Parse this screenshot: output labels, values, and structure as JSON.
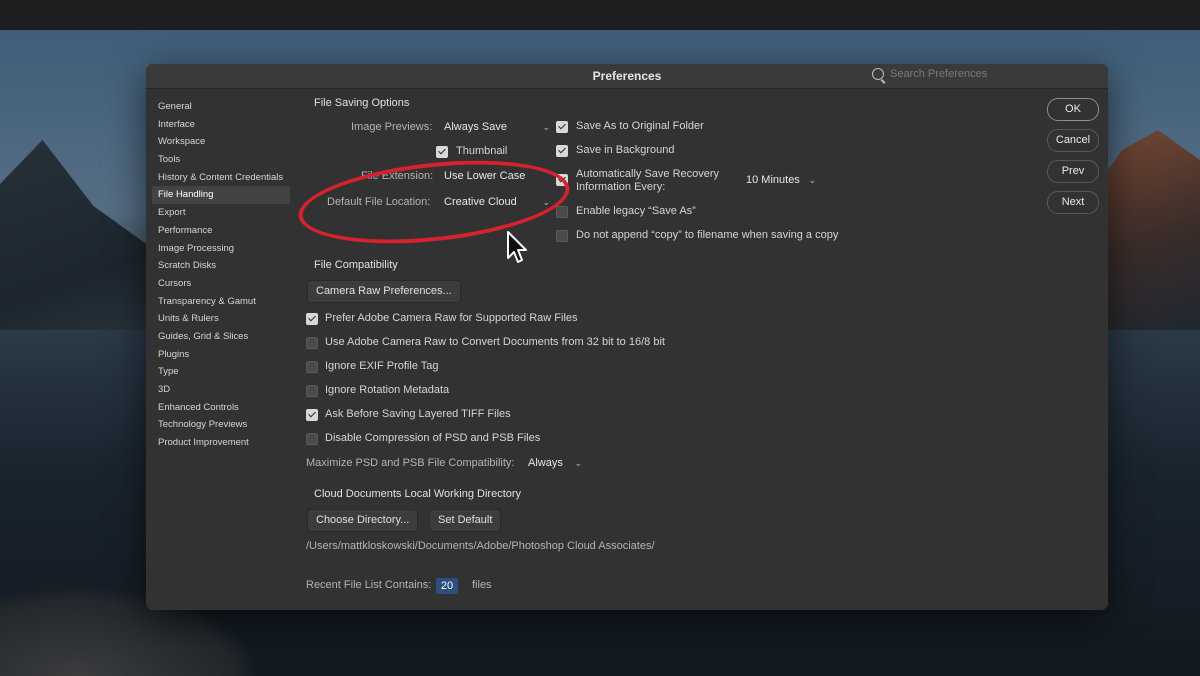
{
  "window": {
    "title": "Preferences",
    "search_placeholder": "Search Preferences"
  },
  "sidebar": {
    "items": [
      {
        "label": "General",
        "active": false
      },
      {
        "label": "Interface",
        "active": false
      },
      {
        "label": "Workspace",
        "active": false
      },
      {
        "label": "Tools",
        "active": false
      },
      {
        "label": "History & Content Credentials",
        "active": false
      },
      {
        "label": "File Handling",
        "active": true
      },
      {
        "label": "Export",
        "active": false
      },
      {
        "label": "Performance",
        "active": false
      },
      {
        "label": "Image Processing",
        "active": false
      },
      {
        "label": "Scratch Disks",
        "active": false
      },
      {
        "label": "Cursors",
        "active": false
      },
      {
        "label": "Transparency & Gamut",
        "active": false
      },
      {
        "label": "Units & Rulers",
        "active": false
      },
      {
        "label": "Guides, Grid & Slices",
        "active": false
      },
      {
        "label": "Plugins",
        "active": false
      },
      {
        "label": "Type",
        "active": false
      },
      {
        "label": "3D",
        "active": false
      },
      {
        "label": "Enhanced Controls",
        "active": false
      },
      {
        "label": "Technology Previews",
        "active": false
      },
      {
        "label": "Product Improvement",
        "active": false
      }
    ]
  },
  "file_saving": {
    "heading": "File Saving Options",
    "image_previews_label": "Image Previews:",
    "image_previews_value": "Always Save",
    "thumbnail_label": "Thumbnail",
    "thumbnail_checked": true,
    "file_extension_label": "File Extension:",
    "file_extension_value": "Use Lower Case",
    "default_location_label": "Default File Location:",
    "default_location_value": "Creative Cloud",
    "save_as_original_label": "Save As to Original Folder",
    "save_as_original_checked": true,
    "save_background_label": "Save in Background",
    "save_background_checked": true,
    "auto_save_label_1": "Automatically Save Recovery",
    "auto_save_label_2": "Information Every:",
    "auto_save_checked": true,
    "auto_save_interval": "10 Minutes",
    "legacy_save_as_label": "Enable legacy “Save As”",
    "legacy_save_as_checked": false,
    "no_copy_label": "Do not append “copy” to filename when saving a copy",
    "no_copy_checked": false
  },
  "file_compat": {
    "heading": "File Compatibility",
    "camera_raw_prefs_button": "Camera Raw Preferences...",
    "options": [
      {
        "label": "Prefer Adobe Camera Raw for Supported Raw Files",
        "checked": true
      },
      {
        "label": "Use Adobe Camera Raw to Convert Documents from 32 bit to 16/8 bit",
        "checked": false
      },
      {
        "label": "Ignore EXIF Profile Tag",
        "checked": false
      },
      {
        "label": "Ignore Rotation Metadata",
        "checked": false
      },
      {
        "label": "Ask Before Saving Layered TIFF Files",
        "checked": true
      },
      {
        "label": "Disable Compression of PSD and PSB Files",
        "checked": false
      }
    ],
    "maximize_label": "Maximize PSD and PSB File Compatibility:",
    "maximize_value": "Always"
  },
  "cloud": {
    "heading": "Cloud Documents Local Working Directory",
    "choose_button": "Choose Directory...",
    "default_button": "Set Default",
    "path": "/Users/mattkloskowski/Documents/Adobe/Photoshop Cloud Associates/"
  },
  "recent": {
    "label": "Recent File List Contains:",
    "value": "20",
    "suffix": "files"
  },
  "buttons": {
    "ok": "OK",
    "cancel": "Cancel",
    "prev": "Prev",
    "next": "Next"
  },
  "colors": {
    "annotation_ring": "#d7212f",
    "field_highlight": "#2d4f7e",
    "dialog_bg": "#323232"
  },
  "icons": {
    "search": "search-icon",
    "checkbox": "checkmark-icon",
    "dropdown": "chevron-down-icon",
    "pointer": "mouse-pointer-icon"
  }
}
